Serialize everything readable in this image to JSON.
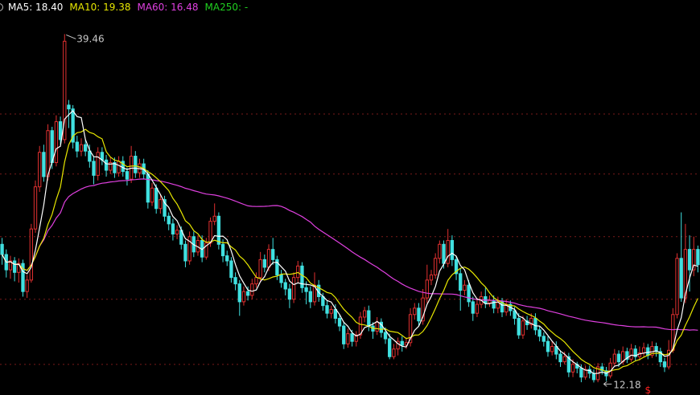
{
  "legend": {
    "ma5": {
      "label": "MA5: 18.40",
      "color": "#ffffff"
    },
    "ma10": {
      "label": "MA10: 19.38",
      "color": "#e6e600"
    },
    "ma60": {
      "label": "MA60: 16.48",
      "color": "#e040e0"
    },
    "ma250": {
      "label": "MA250: -",
      "color": "#20d020"
    }
  },
  "colors": {
    "up": "#e03030",
    "down": "#40e0e0",
    "grid": "#7a1a1a",
    "ma5": "#ffffff",
    "ma10": "#e6e600",
    "ma60": "#e040e0",
    "annotation": "#c8c8c8",
    "marker": "#ff2020"
  },
  "chart_data": {
    "type": "candlestick",
    "y_range": [
      11.2,
      41.5
    ],
    "gridlines": [
      33.2,
      28.5,
      23.6,
      18.7,
      13.6
    ],
    "annotations": {
      "high": {
        "value": 39.46,
        "label": "39.46",
        "candle_index": 15
      },
      "low": {
        "value": 12.18,
        "label": "12.18",
        "candle_index": 144
      }
    },
    "marker": {
      "text": "$",
      "candle_index": 155
    },
    "ma_last": {
      "ma5": 18.4,
      "ma10": 19.38,
      "ma60": 16.48
    },
    "candles": [
      [
        23.0,
        22.2,
        23.5,
        21.4
      ],
      [
        22.2,
        21.0,
        22.6,
        20.4
      ],
      [
        21.0,
        21.7,
        22.1,
        20.3
      ],
      [
        21.7,
        20.8,
        22.0,
        20.1
      ],
      [
        20.8,
        21.5,
        21.9,
        20.0
      ],
      [
        21.5,
        19.3,
        21.8,
        18.9
      ],
      [
        19.3,
        20.2,
        20.6,
        18.8
      ],
      [
        20.2,
        24.2,
        24.6,
        20.0
      ],
      [
        24.2,
        27.5,
        28.0,
        23.9
      ],
      [
        27.5,
        30.2,
        30.7,
        27.1
      ],
      [
        30.2,
        28.3,
        30.8,
        27.9
      ],
      [
        28.3,
        31.9,
        32.4,
        28.0
      ],
      [
        31.9,
        29.4,
        32.2,
        28.9
      ],
      [
        29.4,
        32.6,
        33.1,
        29.1
      ],
      [
        32.6,
        31.2,
        33.0,
        30.8
      ],
      [
        31.2,
        38.9,
        39.46,
        30.9
      ],
      [
        33.9,
        33.6,
        34.3,
        32.1
      ],
      [
        33.6,
        31.0,
        33.9,
        30.5
      ],
      [
        31.0,
        30.3,
        31.5,
        29.8
      ],
      [
        30.3,
        30.8,
        31.3,
        29.9
      ],
      [
        30.8,
        30.3,
        31.2,
        29.9
      ],
      [
        30.3,
        29.5,
        30.8,
        29.0
      ],
      [
        29.5,
        28.4,
        29.9,
        27.7
      ],
      [
        28.4,
        30.2,
        30.6,
        28.0
      ],
      [
        30.2,
        29.6,
        30.6,
        29.2
      ],
      [
        29.6,
        28.8,
        30.0,
        28.3
      ],
      [
        28.8,
        29.4,
        29.8,
        28.5
      ],
      [
        29.4,
        28.6,
        29.8,
        28.2
      ],
      [
        28.6,
        29.5,
        29.9,
        28.3
      ],
      [
        29.5,
        28.7,
        29.9,
        28.3
      ],
      [
        28.7,
        28.1,
        29.0,
        27.6
      ],
      [
        28.1,
        29.9,
        30.7,
        27.8
      ],
      [
        29.9,
        28.6,
        30.3,
        28.2
      ],
      [
        28.6,
        29.3,
        29.7,
        28.2
      ],
      [
        29.3,
        28.5,
        29.7,
        28.1
      ],
      [
        28.5,
        26.3,
        28.8,
        25.8
      ],
      [
        26.3,
        27.4,
        27.8,
        26.0
      ],
      [
        27.4,
        25.8,
        27.7,
        25.4
      ],
      [
        25.8,
        26.5,
        26.9,
        25.4
      ],
      [
        26.5,
        25.2,
        26.8,
        24.8
      ],
      [
        25.2,
        24.6,
        25.5,
        24.1
      ],
      [
        24.6,
        23.8,
        25.0,
        23.3
      ],
      [
        23.8,
        24.1,
        24.5,
        23.4
      ],
      [
        24.1,
        23.0,
        24.4,
        22.6
      ],
      [
        23.0,
        21.7,
        23.3,
        21.2
      ],
      [
        21.7,
        23.6,
        24.0,
        21.4
      ],
      [
        23.6,
        22.4,
        24.0,
        22.0
      ],
      [
        22.4,
        23.3,
        23.7,
        22.1
      ],
      [
        23.3,
        22.0,
        23.7,
        21.6
      ],
      [
        22.0,
        23.1,
        23.5,
        21.8
      ],
      [
        23.1,
        24.8,
        25.1,
        22.8
      ],
      [
        24.8,
        25.2,
        26.2,
        24.5
      ],
      [
        25.2,
        23.0,
        25.5,
        22.6
      ],
      [
        23.0,
        22.1,
        23.4,
        21.6
      ],
      [
        22.1,
        21.7,
        22.5,
        21.3
      ],
      [
        21.7,
        20.4,
        22.0,
        20.0
      ],
      [
        20.4,
        19.9,
        20.8,
        19.4
      ],
      [
        19.9,
        18.5,
        20.2,
        17.4
      ],
      [
        18.5,
        19.3,
        19.7,
        18.2
      ],
      [
        19.3,
        19.0,
        19.7,
        18.6
      ],
      [
        19.0,
        19.9,
        20.3,
        18.7
      ],
      [
        19.9,
        20.4,
        20.8,
        19.6
      ],
      [
        20.4,
        21.8,
        22.4,
        20.1
      ],
      [
        21.8,
        21.2,
        22.2,
        20.8
      ],
      [
        21.2,
        22.6,
        23.0,
        20.9
      ],
      [
        22.6,
        21.8,
        23.5,
        21.4
      ],
      [
        21.8,
        20.6,
        22.1,
        20.2
      ],
      [
        20.6,
        20.0,
        21.0,
        19.6
      ],
      [
        20.0,
        19.5,
        20.3,
        19.0
      ],
      [
        19.5,
        18.7,
        19.9,
        18.0
      ],
      [
        18.7,
        20.4,
        20.8,
        18.4
      ],
      [
        20.4,
        21.3,
        21.7,
        20.0
      ],
      [
        21.3,
        19.6,
        21.6,
        19.2
      ],
      [
        19.6,
        19.3,
        20.1,
        18.3
      ],
      [
        19.3,
        18.5,
        19.7,
        18.0
      ],
      [
        18.5,
        19.8,
        20.8,
        18.2
      ],
      [
        19.8,
        18.9,
        20.2,
        18.5
      ],
      [
        18.9,
        18.2,
        19.2,
        17.8
      ],
      [
        18.2,
        17.6,
        18.6,
        17.2
      ],
      [
        17.6,
        17.9,
        18.2,
        17.2
      ],
      [
        17.9,
        17.2,
        18.3,
        16.8
      ],
      [
        17.2,
        16.6,
        17.5,
        16.2
      ],
      [
        16.6,
        15.2,
        16.9,
        14.8
      ],
      [
        15.2,
        16.0,
        16.4,
        14.9
      ],
      [
        16.0,
        15.4,
        16.3,
        15.0
      ],
      [
        15.4,
        15.9,
        16.2,
        15.0
      ],
      [
        15.9,
        17.3,
        17.7,
        15.6
      ],
      [
        17.3,
        17.8,
        18.1,
        16.9
      ],
      [
        17.8,
        16.6,
        18.2,
        16.2
      ],
      [
        16.6,
        16.2,
        16.9,
        15.6
      ],
      [
        16.2,
        16.9,
        17.3,
        15.9
      ],
      [
        16.9,
        16.1,
        17.2,
        15.7
      ],
      [
        16.1,
        15.6,
        16.5,
        15.2
      ],
      [
        15.6,
        14.2,
        16.0,
        14.0
      ],
      [
        14.2,
        14.8,
        15.2,
        14.0
      ],
      [
        14.8,
        15.4,
        15.7,
        14.3
      ],
      [
        15.4,
        15.1,
        15.8,
        14.6
      ],
      [
        15.1,
        15.3,
        15.7,
        14.8
      ],
      [
        15.3,
        17.5,
        18.0,
        15.0
      ],
      [
        17.5,
        18.0,
        18.4,
        17.1
      ],
      [
        18.0,
        17.0,
        18.4,
        16.6
      ],
      [
        17.0,
        18.8,
        19.5,
        16.7
      ],
      [
        18.8,
        20.2,
        21.4,
        18.4
      ],
      [
        20.2,
        20.6,
        21.0,
        19.8
      ],
      [
        20.6,
        21.9,
        22.3,
        20.3
      ],
      [
        21.9,
        23.0,
        23.3,
        21.5
      ],
      [
        23.0,
        21.5,
        23.3,
        21.1
      ],
      [
        21.5,
        23.3,
        24.2,
        21.2
      ],
      [
        23.3,
        21.8,
        23.7,
        21.3
      ],
      [
        21.8,
        20.7,
        22.1,
        20.2
      ],
      [
        20.7,
        19.4,
        21.1,
        17.8
      ],
      [
        19.4,
        19.8,
        20.2,
        19.0
      ],
      [
        19.8,
        18.5,
        20.2,
        18.1
      ],
      [
        18.5,
        17.6,
        18.9,
        17.0
      ],
      [
        17.6,
        18.3,
        18.8,
        17.3
      ],
      [
        18.3,
        18.9,
        19.3,
        18.0
      ],
      [
        18.9,
        18.4,
        19.6,
        18.0
      ],
      [
        18.4,
        18.6,
        19.0,
        18.1
      ],
      [
        18.6,
        18.0,
        19.0,
        17.6
      ],
      [
        18.0,
        18.5,
        18.9,
        17.6
      ],
      [
        18.5,
        17.7,
        18.8,
        17.3
      ],
      [
        17.7,
        18.3,
        18.7,
        17.4
      ],
      [
        18.3,
        17.8,
        18.6,
        17.4
      ],
      [
        17.8,
        17.2,
        18.1,
        16.7
      ],
      [
        17.2,
        15.9,
        17.6,
        15.6
      ],
      [
        15.9,
        17.0,
        17.4,
        15.6
      ],
      [
        17.0,
        16.7,
        17.4,
        16.3
      ],
      [
        16.7,
        17.2,
        17.6,
        16.4
      ],
      [
        17.2,
        16.3,
        17.6,
        15.9
      ],
      [
        16.3,
        15.8,
        16.6,
        15.4
      ],
      [
        15.8,
        15.4,
        16.1,
        15.0
      ],
      [
        15.4,
        14.6,
        15.8,
        14.2
      ],
      [
        14.6,
        15.0,
        15.4,
        14.3
      ],
      [
        15.0,
        14.4,
        15.4,
        14.0
      ],
      [
        14.4,
        13.8,
        14.7,
        13.4
      ],
      [
        13.8,
        14.2,
        14.6,
        13.6
      ],
      [
        14.2,
        13.0,
        14.5,
        12.6
      ],
      [
        13.0,
        13.6,
        14.0,
        12.6
      ],
      [
        13.6,
        13.3,
        13.8,
        12.9
      ],
      [
        13.3,
        12.6,
        13.6,
        12.2
      ],
      [
        12.6,
        13.2,
        13.5,
        12.4
      ],
      [
        13.2,
        12.9,
        13.5,
        12.5
      ],
      [
        12.9,
        12.4,
        13.2,
        12.18
      ],
      [
        12.4,
        13.4,
        13.7,
        12.2
      ],
      [
        13.4,
        13.1,
        13.7,
        12.8
      ],
      [
        13.1,
        12.7,
        13.4,
        12.3
      ],
      [
        12.7,
        13.7,
        14.1,
        12.5
      ],
      [
        13.7,
        14.4,
        14.8,
        13.5
      ],
      [
        14.4,
        13.8,
        14.7,
        13.4
      ],
      [
        13.8,
        14.6,
        15.0,
        13.6
      ],
      [
        14.6,
        14.0,
        14.9,
        13.7
      ],
      [
        14.0,
        14.8,
        15.2,
        13.8
      ],
      [
        14.8,
        14.2,
        15.1,
        13.9
      ],
      [
        14.2,
        14.5,
        15.0,
        13.9
      ],
      [
        14.5,
        14.9,
        15.3,
        14.2
      ],
      [
        14.9,
        14.3,
        15.2,
        14.0
      ],
      [
        14.3,
        15.0,
        15.4,
        14.1
      ],
      [
        15.0,
        14.6,
        15.3,
        14.2
      ],
      [
        14.6,
        13.8,
        14.9,
        13.4
      ],
      [
        13.8,
        13.4,
        14.1,
        13.0
      ],
      [
        13.4,
        14.7,
        15.5,
        13.2
      ],
      [
        14.7,
        17.5,
        18.0,
        14.5
      ],
      [
        17.5,
        21.9,
        22.3,
        17.2
      ],
      [
        21.9,
        18.8,
        25.5,
        18.5
      ],
      [
        18.8,
        22.6,
        24.6,
        18.4
      ],
      [
        22.6,
        21.0,
        23.7,
        19.3
      ],
      [
        21.0,
        22.6,
        23.6,
        20.5
      ],
      [
        22.6,
        21.4,
        22.9,
        20.8
      ]
    ]
  }
}
